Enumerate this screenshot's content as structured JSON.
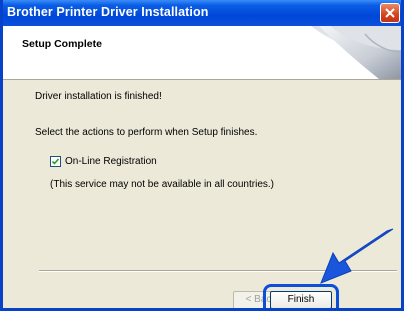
{
  "window": {
    "title": "Brother Printer Driver Installation"
  },
  "header": {
    "title": "Setup Complete"
  },
  "content": {
    "message": "Driver installation is finished!",
    "prompt": "Select the actions to perform when Setup finishes.",
    "registration_label": "On-Line Registration",
    "registration_checked": true,
    "note": "(This service may not be available in all countries.)"
  },
  "buttons": {
    "back_label": "< Back",
    "finish_label": "Finish"
  },
  "colors": {
    "titlebar": "#0047d8",
    "highlight": "#0a4fd8",
    "close": "#d4431c"
  },
  "icons": {
    "close": "close-icon",
    "check": "check-icon",
    "arrow": "pointer-arrow-icon",
    "header_art": "page-curl-icon"
  }
}
